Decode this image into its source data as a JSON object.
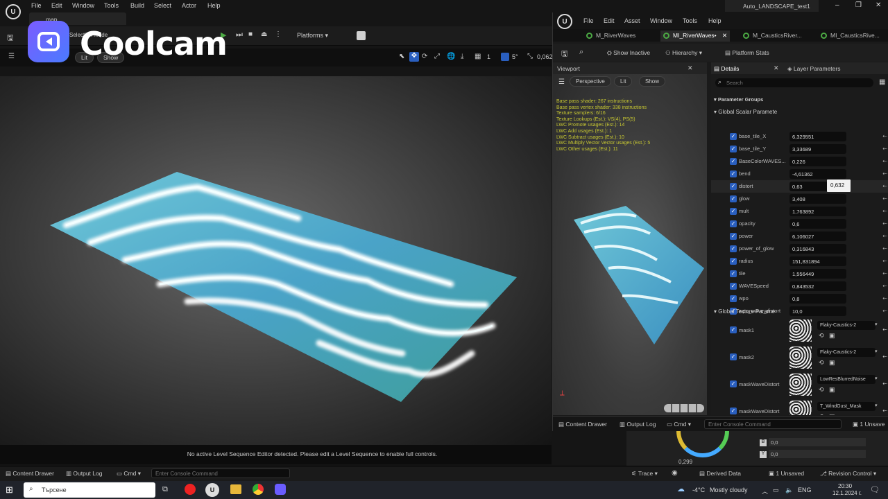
{
  "app": {
    "project_title": "Auto_LANDSCAPE_test1",
    "map_tab": "map",
    "menu": [
      "File",
      "Edit",
      "Window",
      "Tools",
      "Build",
      "Select",
      "Actor",
      "Help"
    ],
    "mode_label": "Selection Mode",
    "platforms_label": "Platforms"
  },
  "viewport": {
    "lit_label": "Lit",
    "show_label": "Show",
    "snap_angle": "5°",
    "snap_grid": "1",
    "zoom_value": "0,062",
    "notice": "No active Level Sequence Editor detected. Please edit a Level Sequence to enable full controls."
  },
  "bottombar": {
    "content_drawer": "Content Drawer",
    "output_log": "Output Log",
    "cmd": "Cmd",
    "console_placeholder": "Enter Console Command",
    "trace": "Trace",
    "derived_data": "Derived Data",
    "unsaved": "1 Unsaved",
    "revision_control": "Revision Control"
  },
  "color_panel": {
    "b_label": "B",
    "b_value": "0,0",
    "y_label": "Y",
    "y_value": "0,0",
    "wheel_value": "0,299"
  },
  "material_editor": {
    "menu": [
      "File",
      "Edit",
      "Asset",
      "Window",
      "Tools",
      "Help"
    ],
    "tabs": [
      "M_RiverWaves",
      "MI_RiverWaves•",
      "M_CausticsRiver...",
      "MI_CausticsRive..."
    ],
    "show_inactive": "Show Inactive",
    "hierarchy": "Hierarchy",
    "platform_stats": "Platform Stats",
    "viewport_tab": "Viewport",
    "perspective": "Perspective",
    "lit": "Lit",
    "show": "Show",
    "details_tab": "Details",
    "layer_params_tab": "Layer Parameters",
    "search_placeholder": "Search",
    "parameter_groups": "Parameter Groups",
    "scalar_group": "Global Scalar Paramete",
    "texture_group": "Global Texture Parame",
    "tooltip_value": "0,632",
    "stats": [
      "Base pass shader: 267 instructions",
      "Base pass vertex shader: 338 instructions",
      "Texture samplers: 6/16",
      "Texture Lookups (Est.): VS(4), PS(5)",
      "LWC Promote usages (Est.): 14",
      "LWC Add usages (Est.): 1",
      "LWC Subtract usages (Est.): 10",
      "LWC Multiply Vector Vector usages (Est.): 5",
      "LWC Other usages (Est.): 11"
    ],
    "scalars": [
      {
        "name": "base_tile_X",
        "value": "6,329551"
      },
      {
        "name": "base_tile_Y",
        "value": "3,33689"
      },
      {
        "name": "BaseColorWAVES...",
        "value": "0,226"
      },
      {
        "name": "bend",
        "value": "-4,61362"
      },
      {
        "name": "distort",
        "value": "0,63"
      },
      {
        "name": "glow",
        "value": "3,408"
      },
      {
        "name": "mult",
        "value": "1,763892"
      },
      {
        "name": "opacity",
        "value": "0,6"
      },
      {
        "name": "power",
        "value": "6,106027"
      },
      {
        "name": "power_of_glow",
        "value": "0,316843"
      },
      {
        "name": "radius",
        "value": "151,831894"
      },
      {
        "name": "tile",
        "value": "1,556449"
      },
      {
        "name": "WAVESpeed",
        "value": "0,843532"
      },
      {
        "name": "wpo",
        "value": "0,8"
      },
      {
        "name": "wpo_wave_distort",
        "value": "10,0"
      }
    ],
    "textures": [
      {
        "name": "mask1",
        "value": "Flaky-Caustics-2"
      },
      {
        "name": "mask2",
        "value": "Flaky-Caustics-2"
      },
      {
        "name": "maskWaveDistort",
        "value": "LowResBlurredNoise"
      },
      {
        "name": "maskWaveDistort",
        "value": "T_WindGust_Mask"
      }
    ],
    "bottom": {
      "content_drawer": "Content Drawer",
      "output_log": "Output Log",
      "cmd": "Cmd",
      "console_placeholder": "Enter Console Command",
      "unsaved": "1 Unsave"
    }
  },
  "watermark": {
    "brand": "Coolcam"
  },
  "taskbar": {
    "search_placeholder": "Търсене",
    "weather_temp": "-4°C",
    "weather_text": "Mostly cloudy",
    "lang": "ENG",
    "time": "20:30",
    "date": "12.1.2024 г."
  }
}
